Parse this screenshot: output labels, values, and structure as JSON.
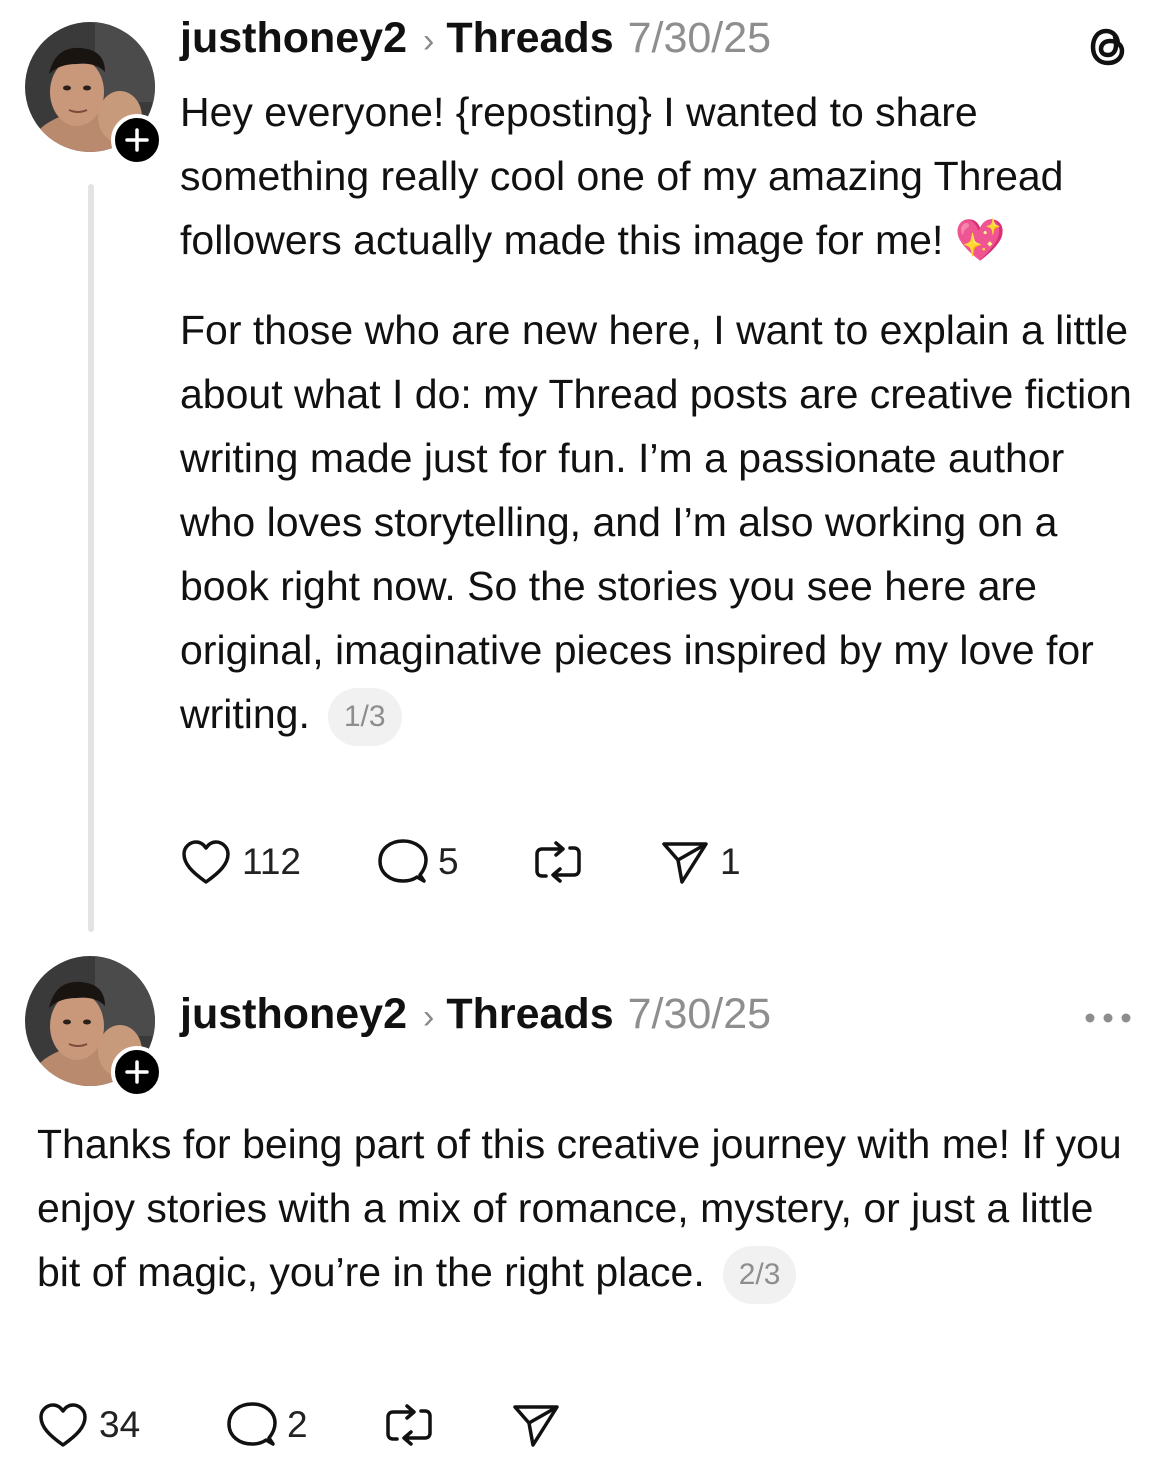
{
  "posts": [
    {
      "username": "justhoney2",
      "breadcrumb_separator": "›",
      "community": "Threads",
      "timestamp": "7/30/25",
      "paragraph_1": "Hey everyone! {reposting} I wanted to share something really cool one of my amazing Thread followers actually made this image for me! 💖",
      "paragraph_2": "For those who are new here, I want to explain a little about what I do: my Thread posts are creative fiction writing made just for fun. I’m a passionate author who loves storytelling, and I’m also working on a book right now. So the stories you see here are original, imaginative pieces inspired by my love for writing.",
      "page_indicator": "1/3",
      "likes": "112",
      "replies": "5",
      "reposts": "",
      "shares": "1",
      "corner_icon": "threads-logo-icon"
    },
    {
      "username": "justhoney2",
      "breadcrumb_separator": "›",
      "community": "Threads",
      "timestamp": "7/30/25",
      "paragraph_1": "Thanks for being part of this creative journey with me! If you enjoy stories with a mix of romance, mystery, or just a little bit of magic, you’re in the right place.",
      "page_indicator": "2/3",
      "likes": "34",
      "replies": "2",
      "reposts": "",
      "shares": "",
      "corner_icon": "more-options-icon"
    }
  ],
  "colors": {
    "text": "#111111",
    "muted": "#8e8e8e",
    "thread_line": "#e3e3e3",
    "pill_bg": "#f1f1f1"
  }
}
